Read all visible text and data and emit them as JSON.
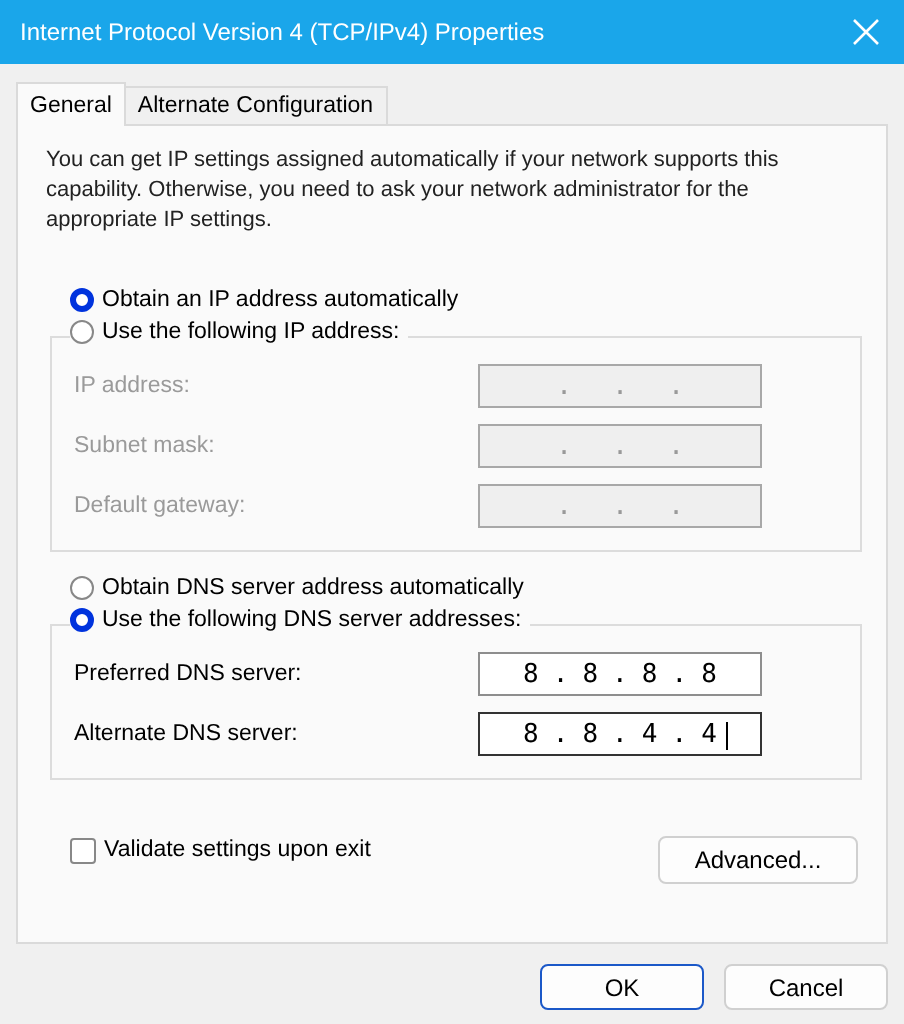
{
  "window": {
    "title": "Internet Protocol Version 4 (TCP/IPv4) Properties"
  },
  "tabs": [
    {
      "label": "General",
      "selected": true
    },
    {
      "label": "Alternate Configuration",
      "selected": false
    }
  ],
  "description": "You can get IP settings assigned automatically if your network supports this capability. Otherwise, you need to ask your network administrator for the appropriate IP settings.",
  "ip_section": {
    "auto_option": {
      "label": "Obtain an IP address automatically",
      "selected": true
    },
    "manual_option": {
      "label": "Use the following IP address:",
      "selected": false
    },
    "fields": [
      {
        "label": "IP address:",
        "disabled": true,
        "focused": false,
        "segments": [
          ".",
          ".",
          "."
        ]
      },
      {
        "label": "Subnet mask:",
        "disabled": true,
        "focused": false,
        "segments": [
          ".",
          ".",
          "."
        ]
      },
      {
        "label": "Default gateway:",
        "disabled": true,
        "focused": false,
        "segments": [
          ".",
          ".",
          "."
        ]
      }
    ]
  },
  "dns_section": {
    "auto_option": {
      "label": "Obtain DNS server address automatically",
      "selected": false
    },
    "manual_option": {
      "label": "Use the following DNS server addresses:",
      "selected": true
    },
    "fields": [
      {
        "label": "Preferred DNS server:",
        "disabled": false,
        "focused": false,
        "segments": [
          "8",
          ".",
          "8",
          ".",
          "8",
          ".",
          "8"
        ]
      },
      {
        "label": "Alternate DNS server:",
        "disabled": false,
        "focused": true,
        "segments": [
          "8",
          ".",
          "8",
          ".",
          "4",
          ".",
          "4"
        ]
      }
    ]
  },
  "validate": {
    "label": "Validate settings upon exit",
    "checked": false
  },
  "advanced_button": "Advanced...",
  "buttons": [
    {
      "label": "OK",
      "default": true
    },
    {
      "label": "Cancel",
      "default": false
    }
  ]
}
